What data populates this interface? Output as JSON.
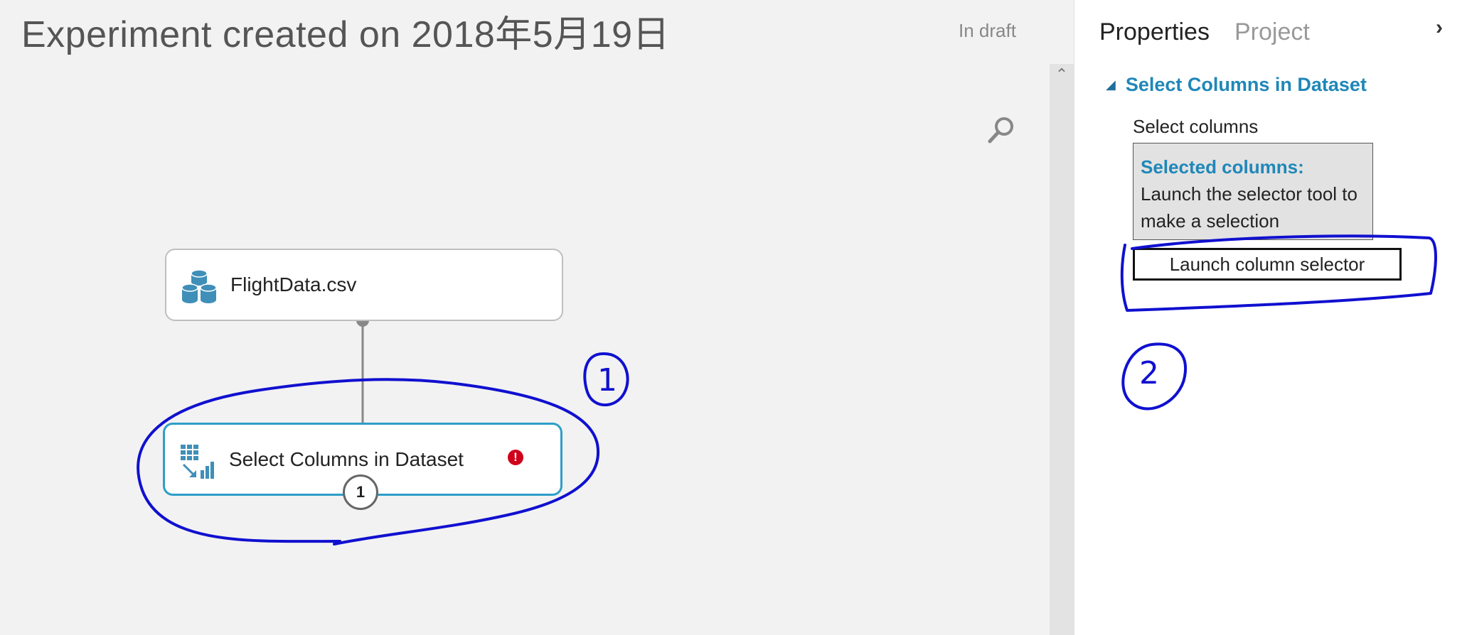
{
  "canvas": {
    "title": "Experiment created on 2018年5月19日",
    "status": "In draft",
    "modules": {
      "dataset": {
        "label": "FlightData.csv",
        "icon": "dataset-cylinders-icon"
      },
      "select_columns": {
        "label": "Select Columns in Dataset",
        "icon": "select-columns-icon",
        "error_mark": "!",
        "port_number": "1"
      }
    }
  },
  "panel": {
    "tabs": [
      "Properties",
      "Project"
    ],
    "section_title": "Select Columns in Dataset",
    "field_label": "Select columns",
    "selected_columns": {
      "heading": "Selected columns:",
      "text": "Launch the selector tool to make a selection"
    },
    "launch_button": "Launch column selector"
  },
  "annotations": {
    "marker_1": "1",
    "marker_2": "2",
    "color": "#1010d0"
  },
  "colors": {
    "accent_blue": "#1f87b8",
    "module_border_selected": "#2e9ec9",
    "error_red": "#d0021b"
  }
}
